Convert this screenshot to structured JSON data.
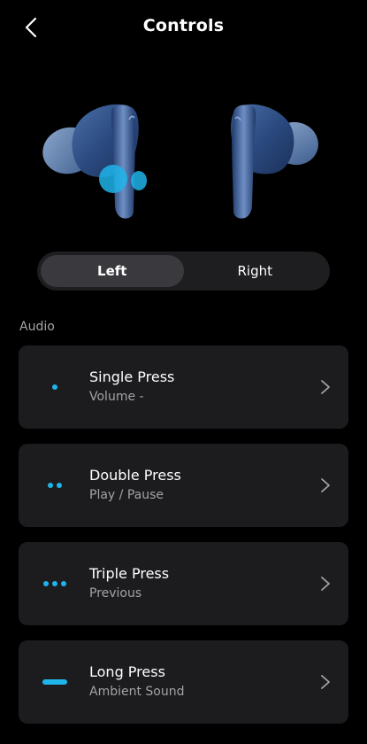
{
  "header": {
    "title": "Controls",
    "back_icon": "chevron-left-icon"
  },
  "earbuds": {
    "body_color": "#2f4f85",
    "tip_color": "#6f8db4",
    "highlight_color": "#1fb4ea"
  },
  "side_toggle": {
    "options": [
      "Left",
      "Right"
    ],
    "selected": "Left"
  },
  "section": {
    "label": "Audio"
  },
  "controls": [
    {
      "name": "Single Press",
      "value": "Volume -",
      "gesture_icon": "single-dot-icon"
    },
    {
      "name": "Double Press",
      "value": "Play / Pause",
      "gesture_icon": "double-dot-icon"
    },
    {
      "name": "Triple Press",
      "value": "Previous",
      "gesture_icon": "triple-dot-icon"
    },
    {
      "name": "Long Press",
      "value": "Ambient Sound",
      "gesture_icon": "long-bar-icon"
    }
  ],
  "colors": {
    "accent": "#1fb4ea",
    "background": "#000000",
    "card": "#1c1c1f"
  }
}
